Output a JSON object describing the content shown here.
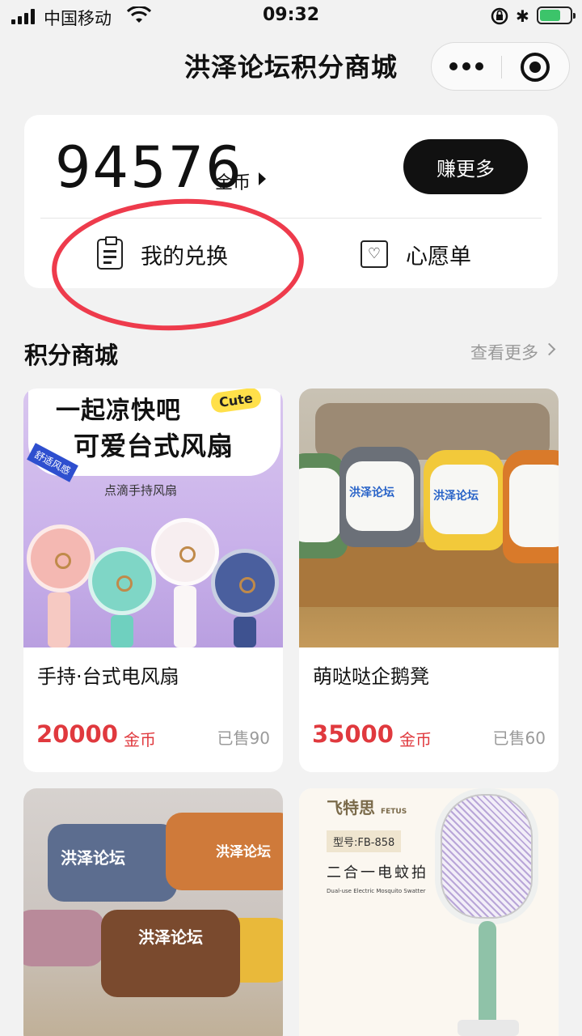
{
  "status_bar": {
    "carrier": "中国移动",
    "time": "09:32"
  },
  "nav": {
    "title": "洪泽论坛积分商城"
  },
  "points_card": {
    "points": "94576",
    "unit": "金币",
    "earn_label": "赚更多",
    "exchange_label": "我的兑换",
    "wishlist_label": "心愿单"
  },
  "section": {
    "title": "积分商城",
    "more_label": "查看更多"
  },
  "products": [
    {
      "name": "手持·台式电风扇",
      "price": "20000",
      "unit": "金币",
      "sold": "已售90",
      "image_text": {
        "line1": "一起凉快吧",
        "line2": "可爱台式风扇",
        "badge": "Cute",
        "tag": "舒适风感",
        "caption": "点滴手持风扇"
      }
    },
    {
      "name": "萌哒哒企鹅凳",
      "price": "35000",
      "unit": "金币",
      "sold": "已售60",
      "image_text": {
        "label": "洪泽论坛"
      }
    },
    {
      "image_text": {
        "label": "洪泽论坛"
      }
    },
    {
      "image_text": {
        "brand": "飞特思",
        "brand_en": "FETUS",
        "model": "型号:FB-858",
        "title": "二合一电蚊拍",
        "subtitle": "Dual-use Electric Mosquito Swatter"
      }
    }
  ],
  "colors": {
    "accent_red": "#e0393e",
    "annotation": "#ee3b4c",
    "button_dark": "#111111",
    "page_bg": "#f2f2f2"
  }
}
